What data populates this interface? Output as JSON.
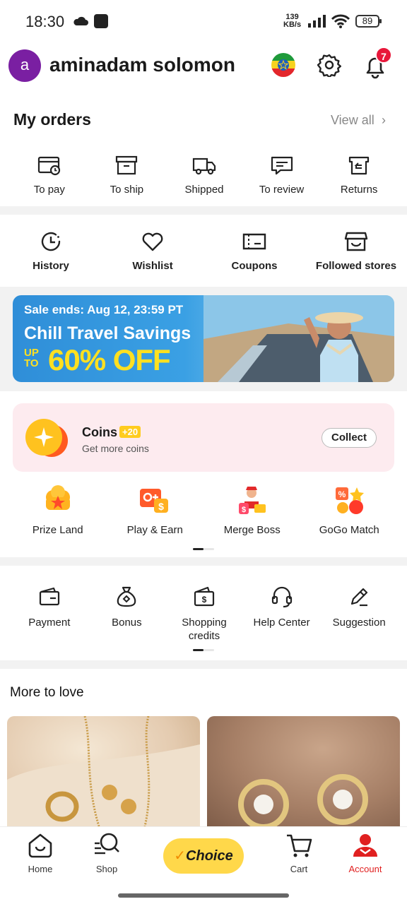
{
  "status_bar": {
    "time": "18:30",
    "speed_value": "139",
    "speed_unit": "KB/s",
    "battery": "89"
  },
  "header": {
    "avatar_letter": "a",
    "username": "aminadam solomon",
    "notification_count": "7"
  },
  "orders": {
    "title": "My orders",
    "view_all": "View all",
    "items": [
      {
        "label": "To pay",
        "icon": "wallet-clock-icon"
      },
      {
        "label": "To ship",
        "icon": "box-icon"
      },
      {
        "label": "Shipped",
        "icon": "truck-icon"
      },
      {
        "label": "To review",
        "icon": "review-icon"
      },
      {
        "label": "Returns",
        "icon": "return-icon"
      }
    ]
  },
  "utilities": [
    {
      "label": "History",
      "icon": "history-icon"
    },
    {
      "label": "Wishlist",
      "icon": "heart-icon"
    },
    {
      "label": "Coupons",
      "icon": "coupon-icon"
    },
    {
      "label": "Followed stores",
      "icon": "store-icon"
    }
  ],
  "banner": {
    "sale_text": "Sale ends: Aug 12, 23:59 PT",
    "title": "Chill Travel Savings",
    "upto_line1": "UP",
    "upto_line2": "TO",
    "discount": "60% OFF"
  },
  "coins": {
    "title": "Coins",
    "badge": "+20",
    "subtitle": "Get more coins",
    "button": "Collect"
  },
  "games": [
    {
      "label": "Prize Land",
      "icon": "prize-land-icon"
    },
    {
      "label": "Play & Earn",
      "icon": "play-earn-icon"
    },
    {
      "label": "Merge Boss",
      "icon": "merge-boss-icon"
    },
    {
      "label": "GoGo Match",
      "icon": "gogo-match-icon"
    }
  ],
  "tools": [
    {
      "label": "Payment",
      "icon": "wallet-icon"
    },
    {
      "label": "Bonus",
      "icon": "money-bag-icon"
    },
    {
      "label": "Shopping credits",
      "icon": "credit-wallet-icon"
    },
    {
      "label": "Help Center",
      "icon": "headset-icon"
    },
    {
      "label": "Suggestion",
      "icon": "pencil-icon"
    }
  ],
  "more": {
    "title": "More to love"
  },
  "bottom_nav": {
    "home": "Home",
    "shop": "Shop",
    "choice": "Choice",
    "cart": "Cart",
    "account": "Account"
  },
  "colors": {
    "accent": "#e02020",
    "badge": "#e8173a",
    "choice": "#ffd84a",
    "coins_bg": "#fdebef",
    "banner_yellow": "#ffe020"
  }
}
